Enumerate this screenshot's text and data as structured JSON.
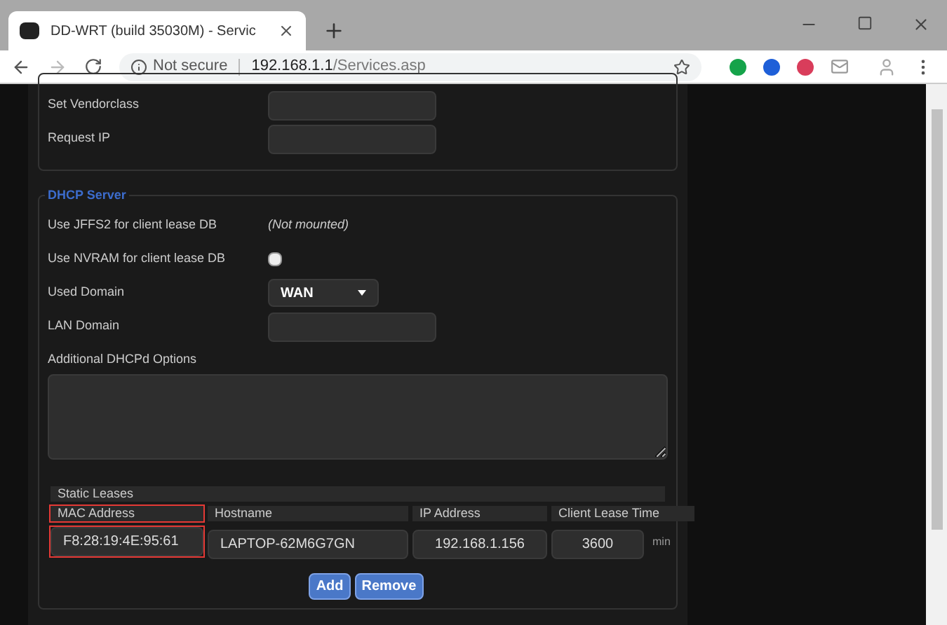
{
  "browser": {
    "tab_title": "DD-WRT (build 35030M) - Servic",
    "security": "Not secure",
    "url_host": "192.168.1.1",
    "url_path": "/Services.asp"
  },
  "dhcp_client": {
    "rows": [
      {
        "label": "Set Vendorclass",
        "kind": "input",
        "value": ""
      },
      {
        "label": "Request IP",
        "kind": "input",
        "value": ""
      }
    ]
  },
  "dhcp_server": {
    "legend": "DHCP Server",
    "rows": [
      {
        "label": "Use JFFS2 for client lease DB",
        "kind": "note",
        "value": "(Not mounted)"
      },
      {
        "label": "Use NVRAM for client lease DB",
        "kind": "checkbox",
        "checked": false
      },
      {
        "label": "Used Domain",
        "kind": "select",
        "value": "WAN"
      },
      {
        "label": "LAN Domain",
        "kind": "input",
        "value": ""
      }
    ],
    "options_label": "Additional DHCPd Options",
    "static_leases": {
      "title": "Static Leases",
      "columns": [
        {
          "label": "MAC Address",
          "highlighted": true
        },
        {
          "label": "Hostname",
          "highlighted": false
        },
        {
          "label": "IP Address",
          "highlighted": false
        },
        {
          "label": "Client Lease Time",
          "highlighted": false
        }
      ],
      "row": {
        "mac": "F8:28:19:4E:95:61",
        "hostname": "LAPTOP-62M6G7GN",
        "ip": "192.168.1.156",
        "lease": "3600",
        "unit": "min"
      }
    },
    "buttons": [
      "Add",
      "Remove"
    ]
  }
}
